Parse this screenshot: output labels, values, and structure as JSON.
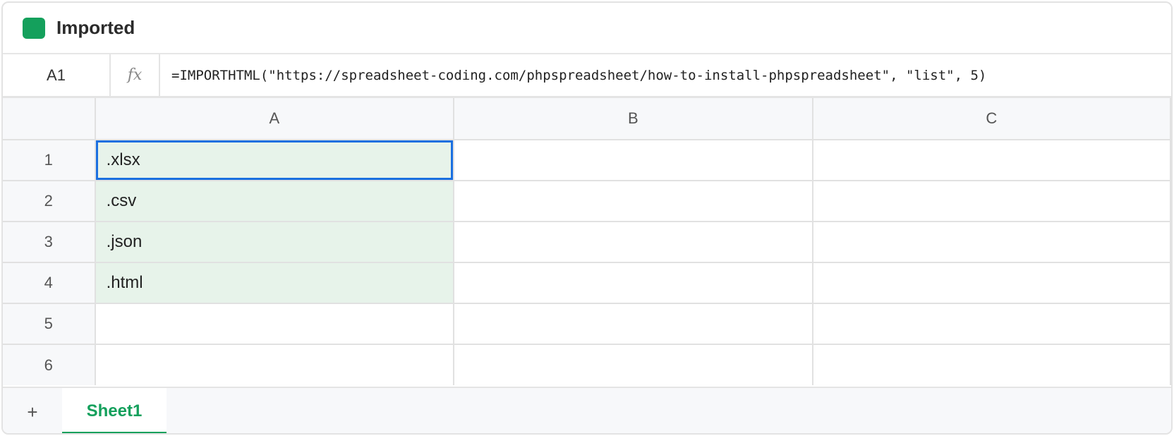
{
  "title": "Imported",
  "formula_bar": {
    "cell_ref": "A1",
    "fx_label": "fx",
    "formula": "=IMPORTHTML(\"https://spreadsheet-coding.com/phpspreadsheet/how-to-install-phpspreadsheet\", \"list\", 5)"
  },
  "grid": {
    "columns": [
      "A",
      "B",
      "C"
    ],
    "rows": [
      {
        "num": "1",
        "cells": [
          ".xlsx",
          "",
          ""
        ]
      },
      {
        "num": "2",
        "cells": [
          ".csv",
          "",
          ""
        ]
      },
      {
        "num": "3",
        "cells": [
          ".json",
          "",
          ""
        ]
      },
      {
        "num": "4",
        "cells": [
          ".html",
          "",
          ""
        ]
      },
      {
        "num": "5",
        "cells": [
          "",
          "",
          ""
        ]
      },
      {
        "num": "6",
        "cells": [
          "",
          "",
          ""
        ]
      }
    ],
    "selected_cell": "A1"
  },
  "tabs": {
    "add_label": "+",
    "sheets": [
      {
        "label": "Sheet1",
        "active": true
      }
    ]
  },
  "colors": {
    "accent": "#14a05c",
    "selection": "#1a6fe0",
    "filled_cell": "#e7f3ea"
  }
}
